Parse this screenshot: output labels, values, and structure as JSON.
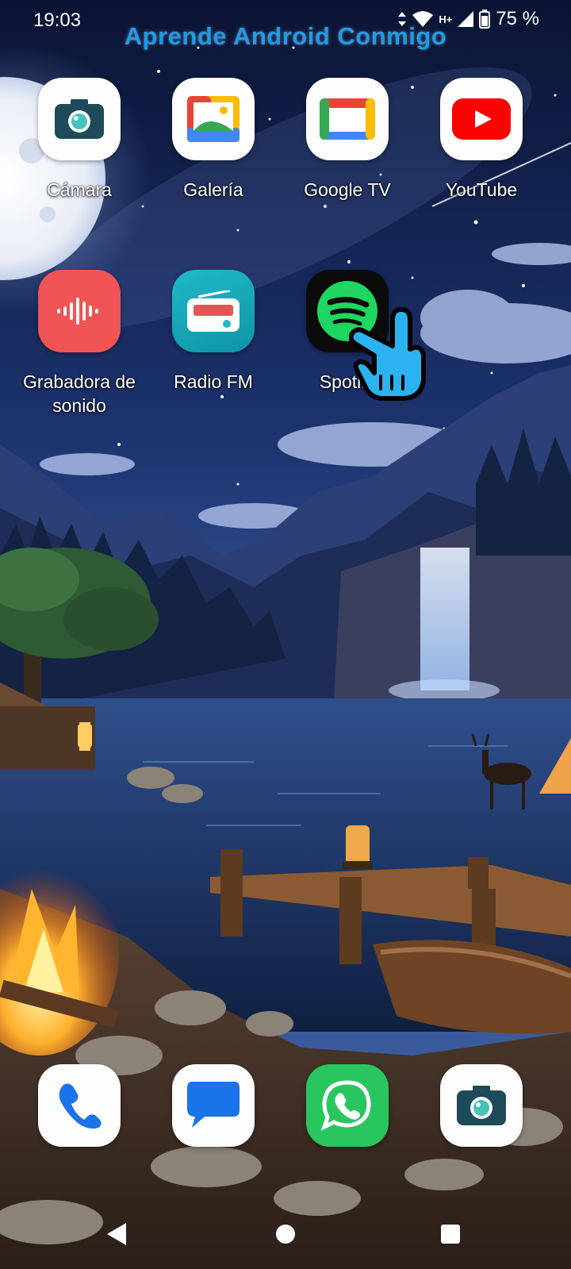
{
  "status_bar": {
    "time": "19:03",
    "network": "H+",
    "battery": "75 %"
  },
  "watermark": "Aprende Android Conmigo",
  "apps_row1": [
    {
      "label": "Cámara",
      "icon": "camera-icon"
    },
    {
      "label": "Galería",
      "icon": "gallery-icon"
    },
    {
      "label": "Google TV",
      "icon": "google-tv-icon"
    },
    {
      "label": "YouTube",
      "icon": "youtube-icon"
    }
  ],
  "apps_row2": [
    {
      "label": "Grabadora de sonido",
      "icon": "sound-recorder-icon"
    },
    {
      "label": "Radio FM",
      "icon": "radio-icon"
    },
    {
      "label": "Spotify",
      "icon": "spotify-icon"
    }
  ],
  "dock": [
    {
      "name": "Teléfono",
      "icon": "phone-icon"
    },
    {
      "name": "Mensajes",
      "icon": "messages-icon"
    },
    {
      "name": "WhatsApp",
      "icon": "whatsapp-icon"
    },
    {
      "name": "Cámara",
      "icon": "camera-icon"
    }
  ],
  "overlay": {
    "icon": "pointing-hand-icon"
  },
  "navigation": {
    "back": "back-icon",
    "home": "home-icon",
    "recents": "recents-icon"
  },
  "colors": {
    "watermark": "#1e9be6",
    "spotify_green": "#1ed760",
    "youtube_red": "#ff0000",
    "whatsapp_green": "#29c660",
    "recorder_red": "#f05454",
    "radio_teal": "#1fb8c8"
  }
}
